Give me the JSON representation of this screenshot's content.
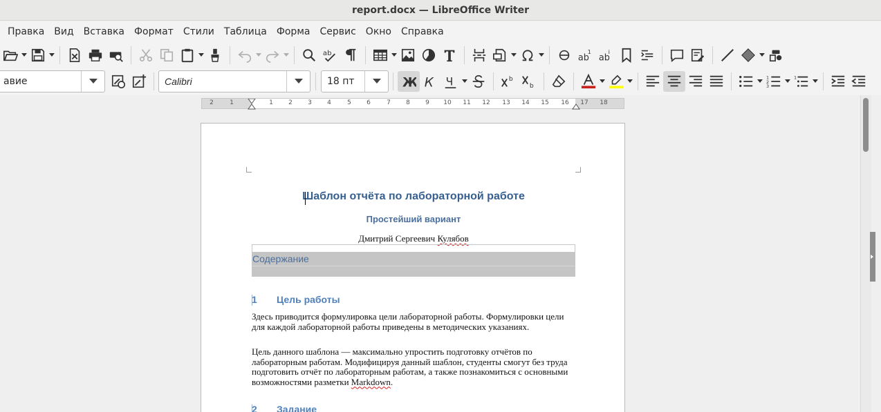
{
  "window": {
    "title": "report.docx — LibreOffice Writer"
  },
  "menu": [
    "Правка",
    "Вид",
    "Вставка",
    "Формат",
    "Стили",
    "Таблица",
    "Форма",
    "Сервис",
    "Окно",
    "Справка"
  ],
  "format_bar": {
    "paragraph_style": "авие",
    "font_name": "Calibri",
    "font_size": "18 пт"
  },
  "ruler": {
    "numbers": [
      "2",
      "1",
      "1",
      "2",
      "3",
      "4",
      "5",
      "6",
      "7",
      "8",
      "9",
      "10",
      "11",
      "12",
      "13",
      "14",
      "15",
      "16",
      "17",
      "18"
    ]
  },
  "document": {
    "title": "Шаблон отчёта по лабораторной работе",
    "subtitle": "Простейший вариант",
    "author_first": "Дмитрий Сергеевич ",
    "author_last": "Кулябов",
    "toc_heading": "Содержание",
    "section1": {
      "number": "1",
      "title": "Цель работы"
    },
    "para1": "Здесь приводится формулировка цели лабораторной работы. Формулировки цели для каждой лабораторной работы приведены в методических указаниях.",
    "para2_main": "Цель данного шаблона — максимально упростить подготовку отчётов по лабораторным работам. Модифицируя данный шаблон, студенты смогут без труда подготовить отчёт по лабораторным работам, а также познакомиться с основными возможностями разметки ",
    "para2_word": "Markdown",
    "para2_end": ".",
    "section2": {
      "number": "2",
      "title": "Задание"
    }
  },
  "colors": {
    "heading": "#365f91",
    "font_color": "#c9211e",
    "highlight": "#ffff00"
  }
}
